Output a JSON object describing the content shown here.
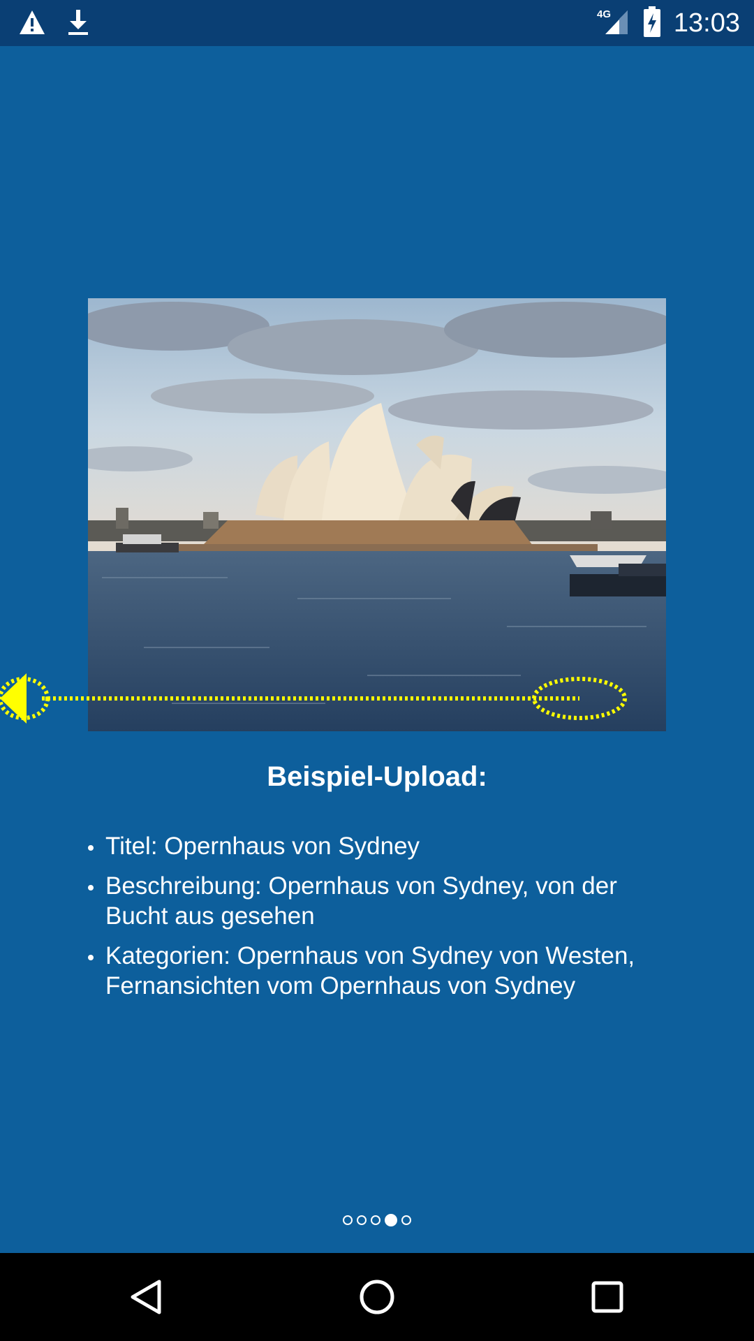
{
  "status_bar": {
    "time": "13:03",
    "network": "4G",
    "icons": [
      "warning-icon",
      "download-icon",
      "signal-icon",
      "battery-charging-icon"
    ]
  },
  "slide": {
    "heading": "Beispiel-Upload:",
    "bullets": [
      "Titel: Opernhaus von Sydney",
      "Beschreibung: Opernhaus von Sydney, von der Bucht aus gesehen",
      "Kategorien: Opernhaus von Sydney von Westen, Fernansichten vom Opernhaus von Sydney"
    ],
    "image": "sydney-opera-house-photo",
    "gesture_hint": "swipe-left-arrow"
  },
  "pager": {
    "total": 5,
    "active_index": 3
  },
  "nav_bar": {
    "buttons": [
      "back-icon",
      "home-icon",
      "recents-icon"
    ]
  },
  "colors": {
    "background": "#0d5f9c",
    "status_bar": "#0a3f74",
    "accent_hint": "#ffff00"
  }
}
